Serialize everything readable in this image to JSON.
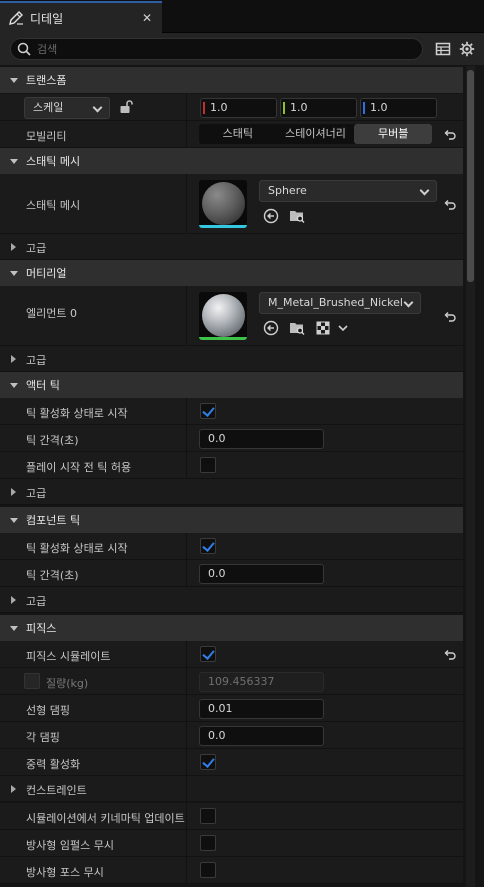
{
  "tab": {
    "title": "디테일",
    "close": "✕"
  },
  "search": {
    "placeholder": "검색"
  },
  "sections": {
    "transform": "트랜스폼",
    "static_mesh": "스태틱 메시",
    "material": "머티리얼",
    "actor_tick": "액터 틱",
    "component_tick": "컴포넌트 틱",
    "physics": "피직스"
  },
  "transform": {
    "scale_label": "스케일",
    "scale_x": "1.0",
    "scale_y": "1.0",
    "scale_z": "1.0",
    "mobility_label": "모빌리티",
    "mobility_options": [
      "스태틱",
      "스테이셔너리",
      "무버블"
    ],
    "mobility_selected": "무버블"
  },
  "static_mesh": {
    "label": "스태틱 메시",
    "value": "Sphere",
    "advanced": "고급"
  },
  "material": {
    "element_label": "엘리먼트 0",
    "value": "M_Metal_Brushed_Nickel",
    "advanced": "고급"
  },
  "actor_tick": {
    "start_enabled": "틱 활성화 상태로 시작",
    "start_enabled_checked": true,
    "interval_label": "틱 간격(초)",
    "interval_value": "0.0",
    "allow_before_play": "플레이 시작 전 틱 허용",
    "allow_before_play_checked": false,
    "advanced": "고급"
  },
  "component_tick": {
    "start_enabled": "틱 활성화 상태로 시작",
    "start_enabled_checked": true,
    "interval_label": "틱 간격(초)",
    "interval_value": "0.0",
    "advanced": "고급"
  },
  "physics": {
    "simulate": "피직스 시뮬레이트",
    "simulate_checked": true,
    "mass_label": "질량(kg)",
    "mass_value": "109.456337",
    "linear_damping": "선형 댐핑",
    "linear_damping_value": "0.01",
    "angular_damping": "각 댐핑",
    "angular_damping_value": "0.0",
    "gravity": "중력 활성화",
    "gravity_checked": true,
    "constraints": "컨스트레인트",
    "kinematic_update": "시뮬레이션에서 키네마틱 업데이트",
    "ignore_radial_impulse": "방사형 임펄스 무시",
    "ignore_radial_force": "방사형 포스 무시"
  },
  "colors": {
    "accent": "#2f7fe6",
    "axis_x": "#c03030",
    "axis_y": "#8fbf2f",
    "axis_z": "#2f6fe6",
    "mesh_underline": "#35c6e0",
    "material_underline": "#3fc24a"
  },
  "icons": [
    "pencil-icon",
    "search-icon",
    "table-icon",
    "gear-icon",
    "reset-arrow-icon",
    "lock-icon",
    "browse-arrow-icon",
    "folder-search-icon",
    "checker-icon"
  ]
}
